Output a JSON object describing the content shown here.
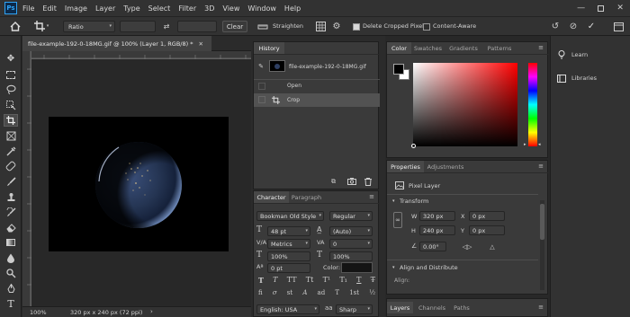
{
  "app": {
    "logo_text": "Ps",
    "menu": [
      "File",
      "Edit",
      "Image",
      "Layer",
      "Type",
      "Select",
      "Filter",
      "3D",
      "View",
      "Window",
      "Help"
    ]
  },
  "options": {
    "ratio_value": "Ratio",
    "clear_label": "Clear",
    "straighten_label": "Straighten",
    "delete_cropped_label": "Delete Cropped Pixels",
    "content_aware_label": "Content-Aware"
  },
  "document": {
    "tab_title": "file-example-192-0-18MG.gif @ 100% (Layer 1, RGB/8) *",
    "zoom": "100%",
    "size_info": "320 px x 240 px (72 ppi)"
  },
  "history": {
    "tab": "History",
    "snapshot_name": "file-example-192-0-18MG.gif",
    "items": [
      "Open",
      "Crop"
    ]
  },
  "character": {
    "tabs": [
      "Character",
      "Paragraph"
    ],
    "font_family": "Bookman Old Style",
    "font_style": "Regular",
    "size": "48 pt",
    "leading": "(Auto)",
    "kerning": "Metrics",
    "tracking": "0",
    "vscale": "100%",
    "hscale": "100%",
    "baseline": "0 pt",
    "color_label": "Color:",
    "type_styles": [
      "T",
      "T",
      "TT",
      "Tt",
      "T¹",
      "T₁",
      "T",
      "T̶"
    ],
    "opentype": [
      "fi",
      "σ",
      "st",
      "A",
      "ad",
      "T",
      "1st",
      "½"
    ],
    "language": "English: USA",
    "antialias_icon": "aa",
    "antialias": "Sharp"
  },
  "color_panel": {
    "tabs": [
      "Color",
      "Swatches",
      "Gradients",
      "Patterns"
    ]
  },
  "properties": {
    "tabs": [
      "Properties",
      "Adjustments"
    ],
    "kind": "Pixel Layer",
    "transform_label": "Transform",
    "w_label": "W",
    "w": "320 px",
    "x_label": "X",
    "x": "0 px",
    "h_label": "H",
    "h": "240 px",
    "y_label": "Y",
    "y": "0 px",
    "angle": "0.00°",
    "align_label": "Align and Distribute",
    "align_sub": "Align:"
  },
  "bottom_tabs": [
    "Layers",
    "Channels",
    "Paths"
  ],
  "learn": {
    "items": [
      "Learn",
      "Libraries"
    ]
  }
}
